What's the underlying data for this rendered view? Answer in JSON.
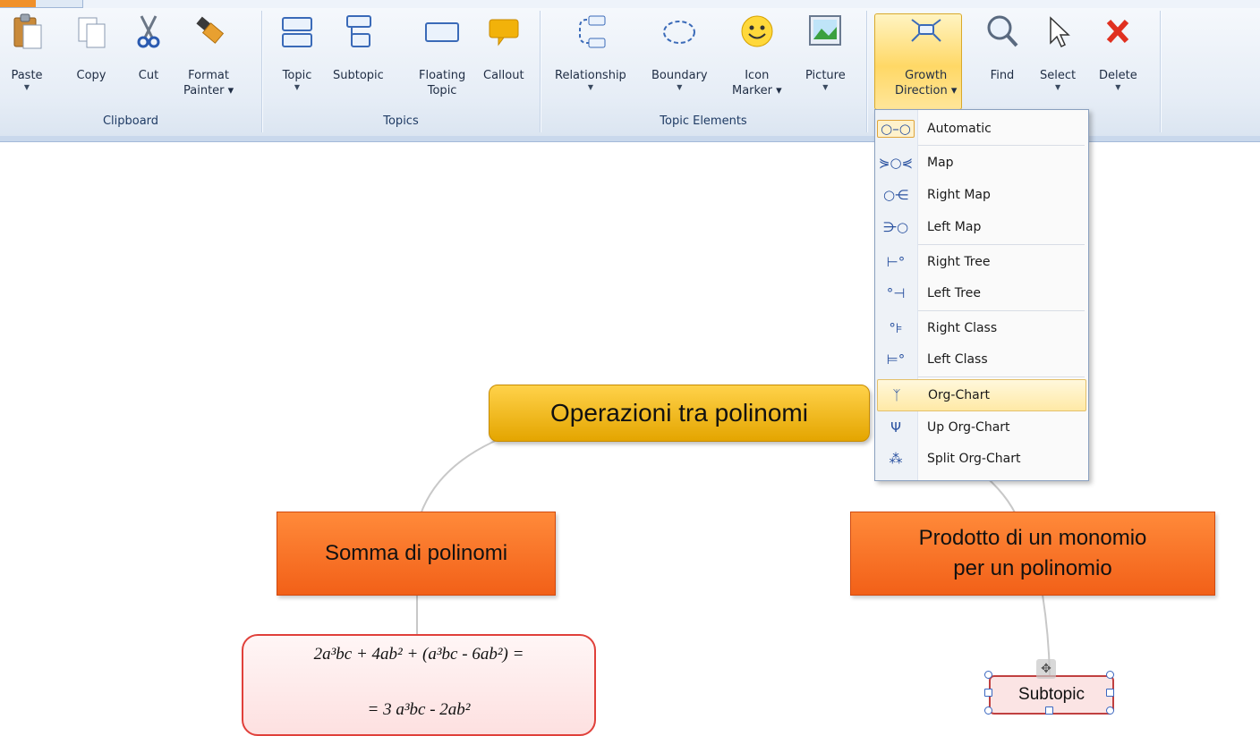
{
  "ribbon": {
    "groups": {
      "clipboard": "Clipboard",
      "topics": "Topics",
      "topic_elements": "Topic Elements"
    },
    "buttons": {
      "paste": "Paste",
      "copy": "Copy",
      "cut": "Cut",
      "format_painter": "Format\nPainter ▾",
      "topic": "Topic",
      "subtopic": "Subtopic",
      "floating_topic": "Floating\nTopic",
      "callout": "Callout",
      "relationship": "Relationship",
      "boundary": "Boundary",
      "icon_marker": "Icon\nMarker ▾",
      "picture": "Picture",
      "growth_direction": "Growth\nDirection ▾",
      "find": "Find",
      "select": "Select",
      "delete": "Delete"
    }
  },
  "growth_menu": {
    "items": [
      {
        "label": "Automatic",
        "icon": "automatic-icon"
      },
      {
        "label": "Map",
        "icon": "map-icon"
      },
      {
        "label": "Right Map",
        "icon": "right-map-icon"
      },
      {
        "label": "Left Map",
        "icon": "left-map-icon"
      },
      {
        "label": "Right Tree",
        "icon": "right-tree-icon"
      },
      {
        "label": "Left Tree",
        "icon": "left-tree-icon"
      },
      {
        "label": "Right Class",
        "icon": "right-class-icon"
      },
      {
        "label": "Left Class",
        "icon": "left-class-icon"
      },
      {
        "label": "Org-Chart",
        "icon": "org-chart-icon"
      },
      {
        "label": "Up Org-Chart",
        "icon": "up-org-chart-icon"
      },
      {
        "label": "Split Org-Chart",
        "icon": "split-org-chart-icon"
      }
    ],
    "highlighted": "Org-Chart"
  },
  "map": {
    "central_topic": "Operazioni tra polinomi",
    "left_topic": "Somma di polinomi",
    "right_topic_line1": "Prodotto di un monomio",
    "right_topic_line2": "per un polinomio",
    "formula_line1": "2a³bc + 4ab² + (a³bc - 6ab²) =",
    "formula_line2": "= 3 a³bc - 2ab²",
    "subtopic": "Subtopic"
  },
  "colors": {
    "central_topic": "#f2b600",
    "main_topic": "#f26a1e",
    "formula_border": "#e0403a",
    "selection_handle": "#3a67c0"
  }
}
